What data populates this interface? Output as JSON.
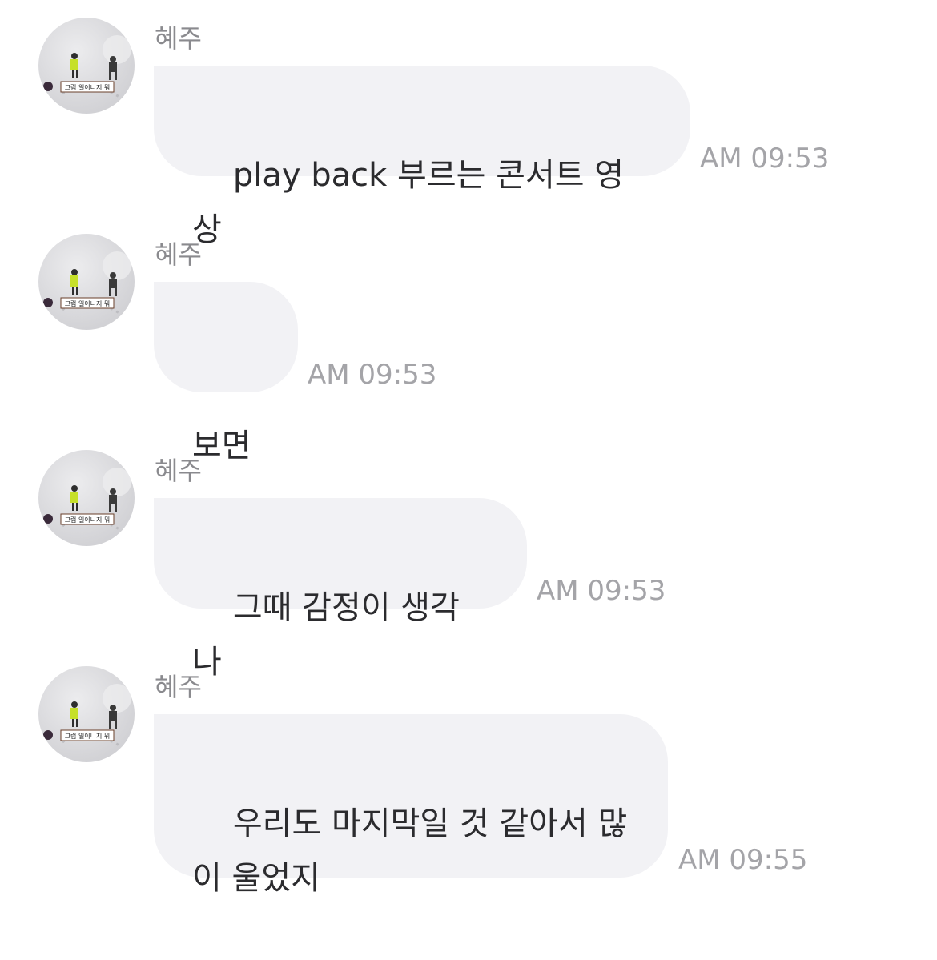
{
  "messages": [
    {
      "sender": "혜주",
      "avatar_caption": "그럼 일이니지 뭐",
      "text": "play back 부르는 콘서트 영상",
      "time": "AM 09:53"
    },
    {
      "sender": "혜주",
      "avatar_caption": "그럼 일이니지 뭐",
      "text": "보면",
      "time": "AM 09:53"
    },
    {
      "sender": "혜주",
      "avatar_caption": "그럼 일이니지 뭐",
      "text": "그때 감정이 생각 나",
      "time": "AM 09:53"
    },
    {
      "sender": "혜주",
      "avatar_caption": "그럼 일이니지 뭐",
      "text": "우리도 마지막일 것 같아서 많\n이 울었지",
      "time": "AM 09:55"
    }
  ],
  "colors": {
    "bubble_bg": "#f2f2f5",
    "sender_text": "#8a8a8e",
    "time_text": "#a4a4a8",
    "message_text": "#2b2b2e"
  }
}
